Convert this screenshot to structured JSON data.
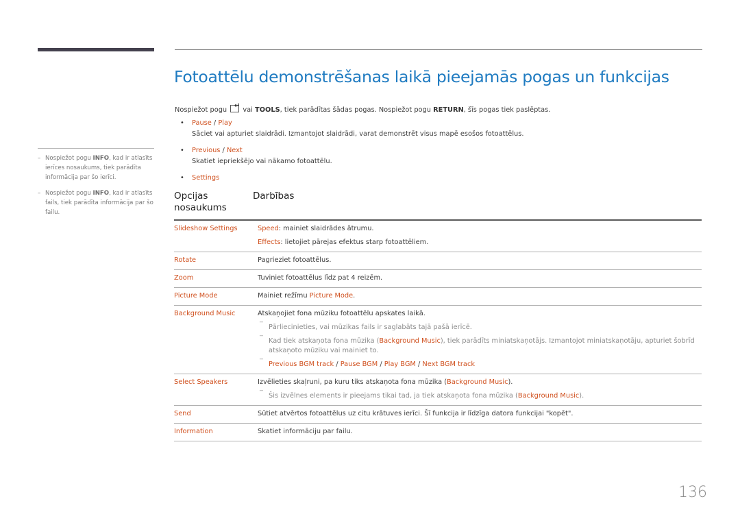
{
  "page": {
    "title": "Fotoattēlu demonstrēšanas laikā pieejamās pogas un funkcijas",
    "page_number": "136",
    "colors": {
      "title": "#1f7bc1",
      "accent": "#d0501e",
      "text": "#3c3c3c",
      "note": "#8a8a8a"
    }
  },
  "sidebar": {
    "notes": [
      {
        "dash": "–",
        "pre": "Nospiežot pogu ",
        "key": "INFO",
        "post": ", kad ir atlasīts ierīces nosaukums, tiek parādīta informācija par šo ierīci."
      },
      {
        "dash": "–",
        "pre": "Nospiežot pogu ",
        "key": "INFO",
        "post": ", kad ir atlasīts fails, tiek parādīta informācija par šo failu."
      }
    ]
  },
  "intro": {
    "part1": "Nospiežot pogu ",
    "icon": "tools-remote-icon",
    "part2": " vai ",
    "key1": "TOOLS",
    "part3": ", tiek parādītas šādas pogas. Nospiežot pogu ",
    "key2": "RETURN",
    "part4": ", šīs pogas tiek paslēptas."
  },
  "bullets": [
    {
      "label_a": "Pause",
      "sep": " / ",
      "label_b": "Play",
      "desc": "Sāciet vai apturiet slaidrādi. Izmantojot slaidrādi, varat demonstrēt visus mapē esošos fotoattēlus."
    },
    {
      "label_a": "Previous",
      "sep": " / ",
      "label_b": "Next",
      "desc": "Skatiet iepriekšējo vai nākamo fotoattēlu."
    },
    {
      "label_a": "Settings",
      "sep": "",
      "label_b": "",
      "desc": ""
    }
  ],
  "table": {
    "headers": [
      "Opcijas nosaukums",
      "Darbības"
    ],
    "rows": {
      "slideshow": {
        "name": "Slideshow Settings",
        "speed_label": "Speed",
        "speed_text": ": mainiet slaidrādes ātrumu.",
        "effects_label": "Effects",
        "effects_text": ": lietojiet pārejas efektus starp fotoattēliem."
      },
      "rotate": {
        "name": "Rotate",
        "text": "Pagrieziet fotoattēlus."
      },
      "zoom": {
        "name": "Zoom",
        "text": "Tuviniet fotoattēlus līdz pat 4 reizēm."
      },
      "picture_mode": {
        "name": "Picture Mode",
        "pre": "Mainiet režīmu ",
        "link": "Picture Mode",
        "post": "."
      },
      "bgm": {
        "name": "Background Music",
        "text": "Atskaņojiet fona mūziku fotoattēlu apskates laikā.",
        "note1": "Pārliecinieties, vai mūzikas fails ir saglabāts tajā pašā ierīcē.",
        "note2_pre": "Kad tiek atskaņota fona mūzika (",
        "note2_link": "Background Music",
        "note2_post": "), tiek parādīts miniatskaņotājs. Izmantojot miniatskaņotāju, apturiet šobrīd atskaņoto mūziku vai mainiet to.",
        "controls": [
          "Previous BGM track",
          "Pause BGM",
          "Play BGM",
          "Next BGM track"
        ],
        "controls_sep": " / "
      },
      "speakers": {
        "name": "Select Speakers",
        "pre": "Izvēlieties skaļruni, pa kuru tiks atskaņota fona mūzika (",
        "link": "Background Music",
        "post": ").",
        "note_pre": "Šis izvēlnes elements ir pieejams tikai tad, ja tiek atskaņota fona mūzika (",
        "note_link": "Background Music",
        "note_post": ")."
      },
      "send": {
        "name": "Send",
        "text": "Sūtiet atvērtos fotoattēlus uz citu krātuves ierīci. Šī funkcija ir līdzīga datora funkcijai \"kopēt\"."
      },
      "information": {
        "name": "Information",
        "text": "Skatiet informāciju par failu."
      }
    }
  }
}
